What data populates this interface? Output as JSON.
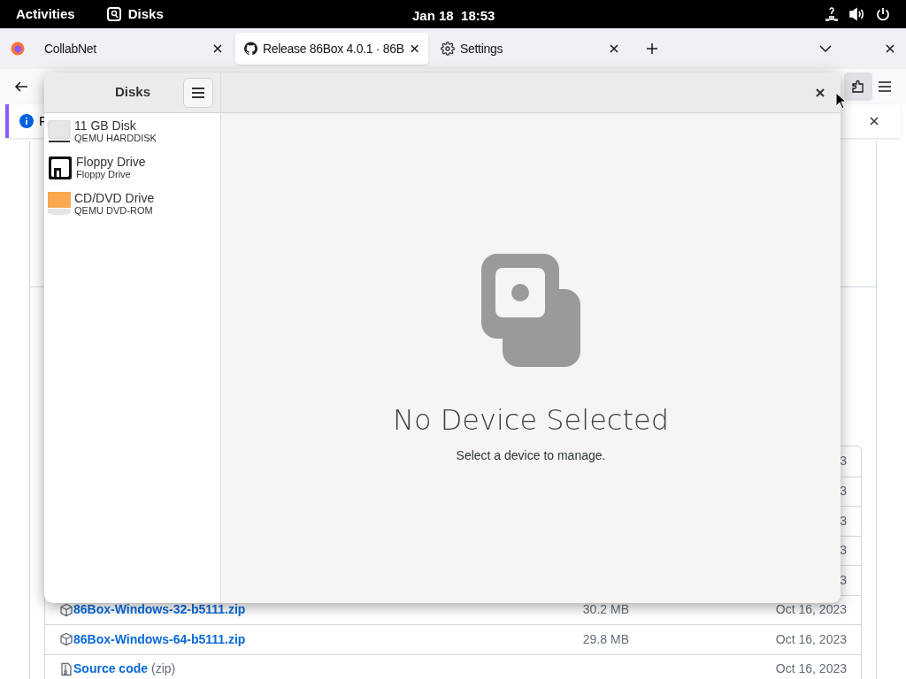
{
  "top_bar": {
    "activities": "Activities",
    "app_name": "Disks",
    "clock": "Jan 18  18:53"
  },
  "browser": {
    "tabs": [
      {
        "title": "CollabNet",
        "kind": "plain",
        "selected": false
      },
      {
        "title": "Release 86Box 4.0.1 · 86B",
        "kind": "github",
        "selected": true
      },
      {
        "title": "Settings",
        "kind": "settings",
        "selected": false
      }
    ],
    "notification": {
      "text": "F"
    },
    "assets": {
      "rows": [
        {
          "kind": "hidden",
          "date": "3"
        },
        {
          "kind": "hidden",
          "date": "3"
        },
        {
          "kind": "hidden",
          "date": "3"
        },
        {
          "kind": "hidden",
          "date": "3"
        },
        {
          "kind": "hidden",
          "date": "3"
        },
        {
          "kind": "package",
          "name": "86Box-Windows-32-b5111.zip",
          "size": "30.2 MB",
          "date": "Oct 16, 2023"
        },
        {
          "kind": "package",
          "name": "86Box-Windows-64-b5111.zip",
          "size": "29.8 MB",
          "date": "Oct 16, 2023"
        },
        {
          "kind": "source",
          "name": "Source code",
          "suffix": "(zip)",
          "date": "Oct 16, 2023"
        }
      ]
    }
  },
  "disks_window": {
    "title": "Disks",
    "devices": [
      {
        "name": "11 GB Disk",
        "model": "QEMU HARDDISK",
        "kind": "hdd",
        "selected": false
      },
      {
        "name": "Floppy Drive",
        "model": "Floppy Drive",
        "kind": "floppy",
        "selected": false
      },
      {
        "name": "CD/DVD Drive",
        "model": "QEMU DVD-ROM",
        "kind": "optical",
        "selected": false
      }
    ],
    "empty_state": {
      "title": "No Device Selected",
      "subtitle": "Select a device to manage."
    }
  }
}
